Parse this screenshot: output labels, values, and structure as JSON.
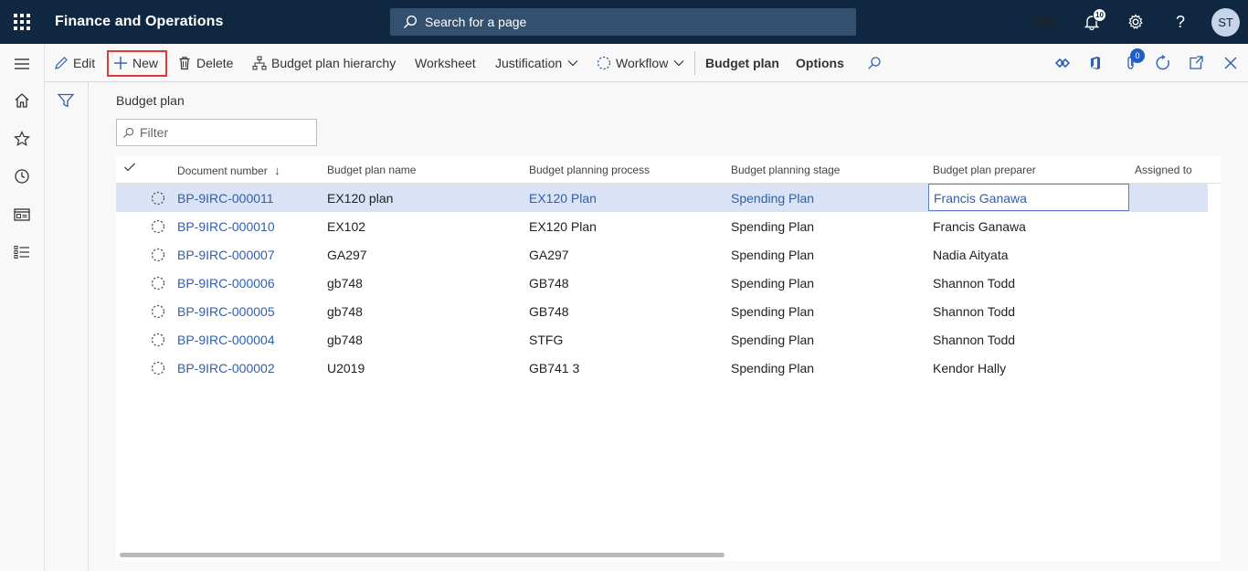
{
  "topbar": {
    "app_title": "Finance and Operations",
    "search_placeholder": "Search for a page",
    "company": "9IRC",
    "notification_count": "10",
    "avatar_initials": "ST",
    "background_color": "#0f2741"
  },
  "actions": {
    "edit": "Edit",
    "new": "New",
    "delete": "Delete",
    "hierarchy": "Budget plan hierarchy",
    "worksheet": "Worksheet",
    "justification": "Justification",
    "workflow": "Workflow",
    "budget_plan_tab": "Budget plan",
    "options_tab": "Options",
    "attachments_count": "0"
  },
  "page": {
    "caption": "Budget plan",
    "filter_placeholder": "Filter"
  },
  "grid": {
    "columns": [
      "Document number",
      "Budget plan name",
      "Budget planning process",
      "Budget planning stage",
      "Budget plan preparer",
      "Assigned to"
    ],
    "sort_indicator": "↓",
    "rows": [
      {
        "doc": "BP-9IRC-000011",
        "name": "EX120 plan",
        "process": "EX120 Plan",
        "stage": "Spending Plan",
        "preparer": "Francis Ganawa",
        "assigned": ""
      },
      {
        "doc": "BP-9IRC-000010",
        "name": "EX102",
        "process": "EX120 Plan",
        "stage": "Spending Plan",
        "preparer": "Francis Ganawa",
        "assigned": ""
      },
      {
        "doc": "BP-9IRC-000007",
        "name": "GA297",
        "process": "GA297",
        "stage": "Spending Plan",
        "preparer": "Nadia Aityata",
        "assigned": ""
      },
      {
        "doc": "BP-9IRC-000006",
        "name": "gb748",
        "process": "GB748",
        "stage": "Spending Plan",
        "preparer": "Shannon Todd",
        "assigned": ""
      },
      {
        "doc": "BP-9IRC-000005",
        "name": "gb748",
        "process": "GB748",
        "stage": "Spending Plan",
        "preparer": "Shannon Todd",
        "assigned": ""
      },
      {
        "doc": "BP-9IRC-000004",
        "name": "gb748",
        "process": "STFG",
        "stage": "Spending Plan",
        "preparer": "Shannon Todd",
        "assigned": ""
      },
      {
        "doc": "BP-9IRC-000002",
        "name": "U2019",
        "process": "GB741 3",
        "stage": "Spending Plan",
        "preparer": "Kendor Hally",
        "assigned": ""
      }
    ]
  },
  "icons": {
    "app_launcher": "waffle-icon",
    "search": "search-icon",
    "notifications": "bell-icon",
    "settings": "gear-icon",
    "help": "help-icon",
    "row_status": "workflow-spinner-icon"
  }
}
